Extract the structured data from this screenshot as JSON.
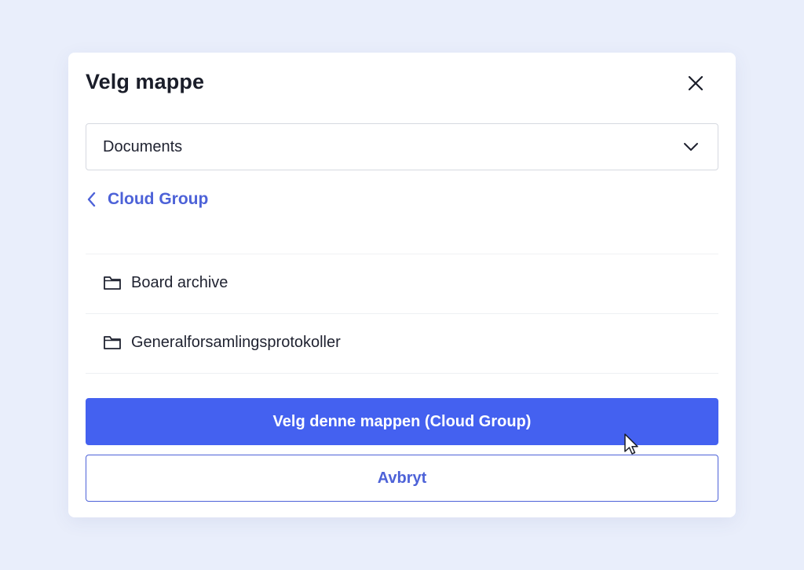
{
  "dialog": {
    "title": "Velg mappe",
    "close_icon": "close-icon"
  },
  "location_select": {
    "value": "Documents",
    "icon": "chevron-down-icon"
  },
  "breadcrumb": {
    "back_label": "Cloud Group",
    "icon": "chevron-left-icon"
  },
  "folders": [
    {
      "name": "Board archive",
      "icon": "folder-icon"
    },
    {
      "name": "Generalforsamlingsprotokoller",
      "icon": "folder-icon"
    }
  ],
  "actions": {
    "confirm_label": "Velg denne mappen (Cloud Group)",
    "cancel_label": "Avbryt"
  },
  "colors": {
    "backdrop": "#e9eefb",
    "accent": "#4461f0",
    "link": "#4d62d8",
    "text": "#1a1d29"
  }
}
